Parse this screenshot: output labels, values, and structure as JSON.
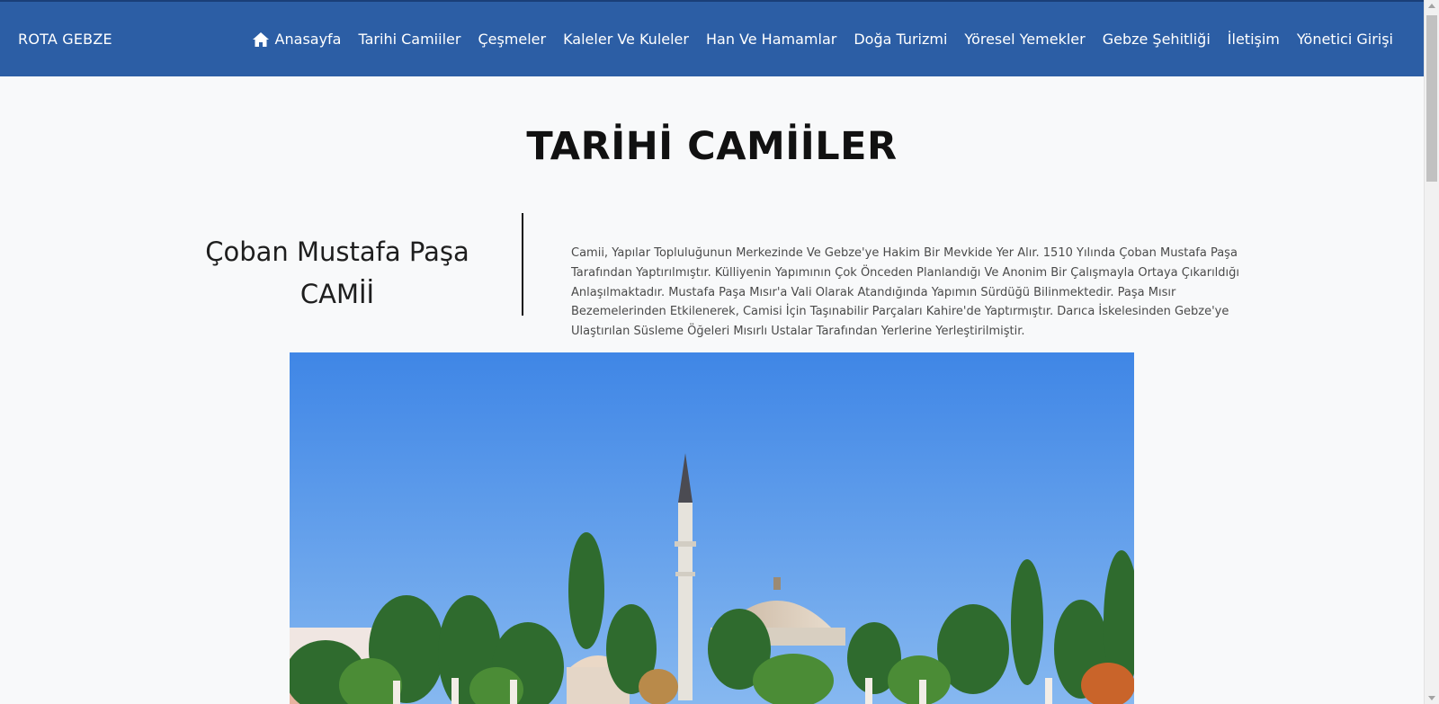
{
  "navbar": {
    "brand": "ROTA GEBZE",
    "items": [
      {
        "label": "Anasayfa",
        "icon": "home-icon"
      },
      {
        "label": "Tarihi Camiiler"
      },
      {
        "label": "Çeşmeler"
      },
      {
        "label": "Kaleler Ve Kuleler"
      },
      {
        "label": "Han Ve Hamamlar"
      },
      {
        "label": "Doğa Turizmi"
      },
      {
        "label": "Yöresel Yemekler"
      },
      {
        "label": "Gebze Şehitliği"
      },
      {
        "label": "İletişim"
      },
      {
        "label": "Yönetici Girişi"
      }
    ]
  },
  "main": {
    "title": "TARİHİ CAMİİLER",
    "mosque": {
      "name_line1": "Çoban Mustafa Paşa",
      "name_line2": "CAMİİ",
      "description": "Camii, Yapılar Topluluğunun Merkezinde Ve Gebze'ye Hakim Bir Mevkide Yer Alır. 1510 Yılında Çoban Mustafa Paşa Tarafından Yaptırılmıştır. Külliyenin Yapımının Çok Önceden Planlandığı Ve Anonim Bir Çalışmayla Ortaya Çıkarıldığı Anlaşılmaktadır. Mustafa Paşa Mısır'a Vali Olarak Atandığında Yapımın Sürdüğü Bilinmektedir. Paşa Mısır Bezemelerinden Etkilenerek, Camisi İçin Taşınabilir Parçaları Kahire'de Yaptırmıştır. Darıca İskelesinden Gebze'ye Ulaştırılan Süsleme Öğeleri Mısırlı Ustalar Tarafından Yerlerine Yerleştirilmiştir."
    }
  },
  "colors": {
    "navbar_bg": "#2c5ea5",
    "page_bg": "#f8f9fa",
    "sky": "#5f9be6"
  }
}
